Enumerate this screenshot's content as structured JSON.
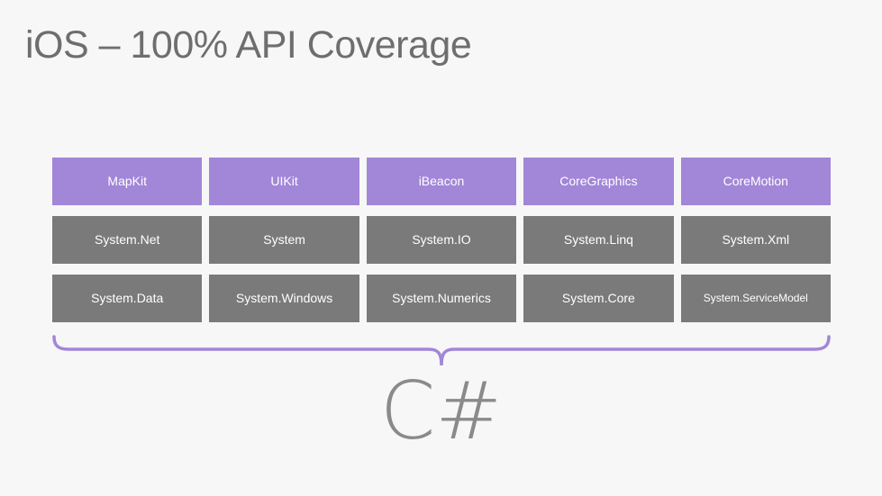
{
  "slide": {
    "background_color": "#f7f7f7",
    "title": "iOS – 100% API Coverage",
    "title_color": "#6e6e6e",
    "brace_color": "#a286d8",
    "footer_mark": "C#",
    "footer_mark_color": "#8a8a8a"
  },
  "palette": {
    "ios_cell": "#a286d8",
    "dotnet_cell": "#7a7a7a",
    "cell_text": "#ffffff"
  },
  "grid": {
    "columns": 5,
    "rows": [
      {
        "row_name": "ios-apis",
        "color": "#a286d8",
        "cells": [
          {
            "label": "MapKit",
            "size": "normal"
          },
          {
            "label": "UIKit",
            "size": "normal"
          },
          {
            "label": "iBeacon",
            "size": "normal"
          },
          {
            "label": "CoreGraphics",
            "size": "normal"
          },
          {
            "label": "CoreMotion",
            "size": "normal"
          }
        ]
      },
      {
        "row_name": "dotnet-apis-1",
        "color": "#7a7a7a",
        "cells": [
          {
            "label": "System.Net",
            "size": "normal"
          },
          {
            "label": "System",
            "size": "normal"
          },
          {
            "label": "System.IO",
            "size": "normal"
          },
          {
            "label": "System.Linq",
            "size": "normal"
          },
          {
            "label": "System.Xml",
            "size": "normal"
          }
        ]
      },
      {
        "row_name": "dotnet-apis-2",
        "color": "#7a7a7a",
        "cells": [
          {
            "label": "System.Data",
            "size": "normal"
          },
          {
            "label": "System.Windows",
            "size": "normal"
          },
          {
            "label": "System.Numerics",
            "size": "normal"
          },
          {
            "label": "System.Core",
            "size": "normal"
          },
          {
            "label": "System.ServiceModel",
            "size": "small"
          }
        ]
      }
    ]
  }
}
